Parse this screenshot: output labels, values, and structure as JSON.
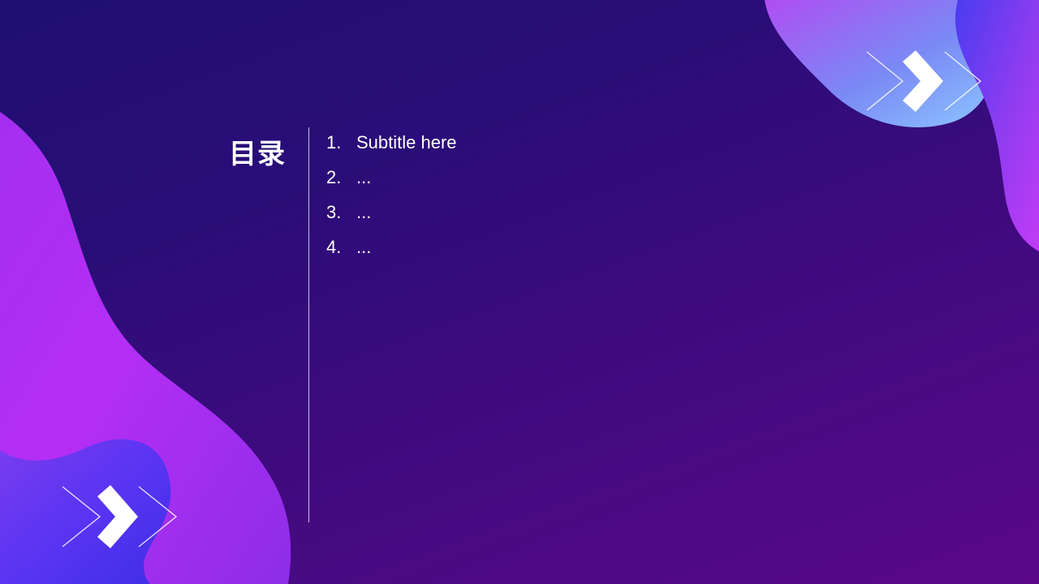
{
  "slide": {
    "title": "目录",
    "items": [
      {
        "number": "1.",
        "label": "Subtitle here"
      },
      {
        "number": "2.",
        "label": "..."
      },
      {
        "number": "3.",
        "label": "..."
      },
      {
        "number": "4.",
        "label": "..."
      }
    ]
  },
  "decorations": {
    "top_right_icon": "chevron-arrows-icon",
    "bottom_left_icon": "chevron-arrows-icon"
  },
  "colors": {
    "background_start": "#1f0f72",
    "background_end": "#5a0888",
    "blob_purple": "#b12cf0",
    "blob_blue": "#4a2ef0",
    "blob_light_blue": "#7fb6ff",
    "text": "#ffffff"
  }
}
